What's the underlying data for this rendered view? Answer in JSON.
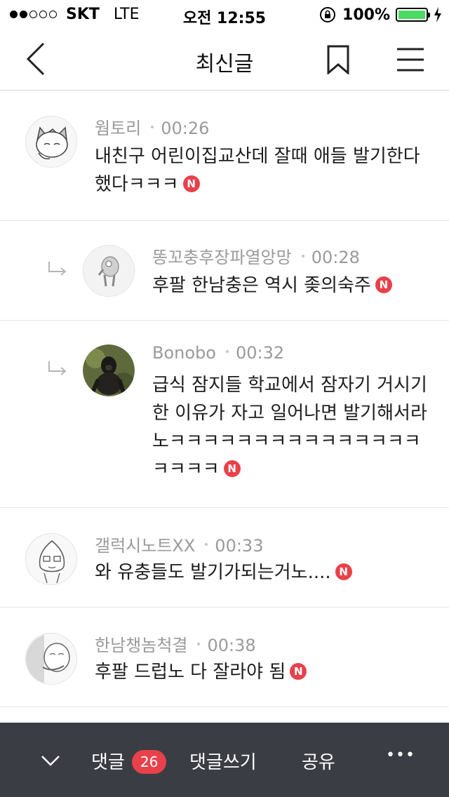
{
  "status_bar": {
    "carrier": "SKT",
    "network": "LTE",
    "time": "오전 12:55",
    "battery": "100%",
    "battery_level": 1.0
  },
  "header": {
    "title": "최신글",
    "icons": [
      "back-chevron-icon",
      "bookmark-icon",
      "menu-icon"
    ]
  },
  "comments": [
    {
      "author": "웜토리",
      "time": "00:26",
      "text": "내친구 어린이집교산데 잘때 애들 발기한다 했다ㅋㅋㅋ",
      "badge": "N",
      "reply": false
    },
    {
      "author": "똥꼬충후장파열앙망",
      "time": "00:28",
      "text": "후팔 한남충은 역시 좆의숙주",
      "badge": "N",
      "reply": true
    },
    {
      "author": "Bonobo",
      "time": "00:32",
      "text": "급식 잠지들 학교에서 잠자기 거시기한 이유가 자고 일어나면 발기해서라노ㅋㅋㅋㅋㅋㅋㅋㅋㅋㅋㅋㅋㅋㅋㅋㅋㅋㅋㅋ",
      "badge": "N",
      "reply": true
    },
    {
      "author": "갤럭시노트XX",
      "time": "00:33",
      "text": "와 유충들도 발기가되는거노....",
      "badge": "N",
      "reply": false
    },
    {
      "author": "한남챙놈척결",
      "time": "00:38",
      "text": "후팔 드럽노 다 잘라야 됨",
      "badge": "N",
      "reply": false
    }
  ],
  "bottom_bar": {
    "comments_label": "댓글",
    "comments_count": "26",
    "write_label": "댓글쓰기",
    "share_label": "공유",
    "more_label": "•••"
  },
  "colors": {
    "badge_red": "#e8414a",
    "bottom_bar": "#3a3d44",
    "battery_green": "#4cd964"
  }
}
